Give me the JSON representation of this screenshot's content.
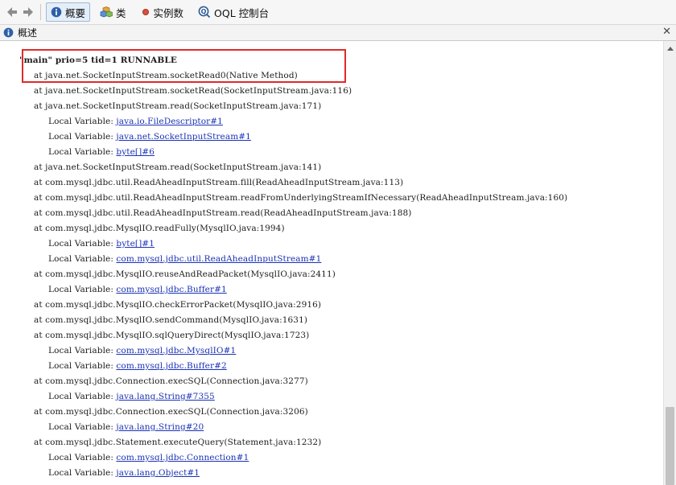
{
  "toolbar": {
    "tabs": [
      {
        "label": "概要",
        "icon": "info-icon"
      },
      {
        "label": "类",
        "icon": "classes-icon"
      },
      {
        "label": "实例数",
        "icon": "instances-icon"
      },
      {
        "label": "OQL 控制台",
        "icon": "oql-icon"
      }
    ]
  },
  "panel": {
    "title": "概述"
  },
  "thread": {
    "header": "\"main\" prio=5 tid=1 RUNNABLE",
    "lines": [
      {
        "kind": "frame",
        "text": "at java.net.SocketInputStream.socketRead0(Native Method)"
      },
      {
        "kind": "frame",
        "text": "at java.net.SocketInputStream.socketRead(SocketInputStream.java:116)"
      },
      {
        "kind": "frame",
        "text": "at java.net.SocketInputStream.read(SocketInputStream.java:171)"
      },
      {
        "kind": "local",
        "label": "Local Variable: ",
        "link": "java.io.FileDescriptor#1"
      },
      {
        "kind": "local",
        "label": "Local Variable: ",
        "link": "java.net.SocketInputStream#1"
      },
      {
        "kind": "local",
        "label": "Local Variable: ",
        "link": "byte[]#6"
      },
      {
        "kind": "frame",
        "text": "at java.net.SocketInputStream.read(SocketInputStream.java:141)"
      },
      {
        "kind": "frame",
        "text": "at com.mysql.jdbc.util.ReadAheadInputStream.fill(ReadAheadInputStream.java:113)"
      },
      {
        "kind": "frame",
        "text": "at com.mysql.jdbc.util.ReadAheadInputStream.readFromUnderlyingStreamIfNecessary(ReadAheadInputStream.java:160)"
      },
      {
        "kind": "frame",
        "text": "at com.mysql.jdbc.util.ReadAheadInputStream.read(ReadAheadInputStream.java:188)"
      },
      {
        "kind": "frame",
        "text": "at com.mysql.jdbc.MysqlIO.readFully(MysqlIO.java:1994)"
      },
      {
        "kind": "local",
        "label": "Local Variable: ",
        "link": "byte[]#1"
      },
      {
        "kind": "local",
        "label": "Local Variable: ",
        "link": "com.mysql.jdbc.util.ReadAheadInputStream#1"
      },
      {
        "kind": "frame",
        "text": "at com.mysql.jdbc.MysqlIO.reuseAndReadPacket(MysqlIO.java:2411)"
      },
      {
        "kind": "local",
        "label": "Local Variable: ",
        "link": "com.mysql.jdbc.Buffer#1"
      },
      {
        "kind": "frame",
        "text": "at com.mysql.jdbc.MysqlIO.checkErrorPacket(MysqlIO.java:2916)"
      },
      {
        "kind": "frame",
        "text": "at com.mysql.jdbc.MysqlIO.sendCommand(MysqlIO.java:1631)"
      },
      {
        "kind": "frame",
        "text": "at com.mysql.jdbc.MysqlIO.sqlQueryDirect(MysqlIO.java:1723)"
      },
      {
        "kind": "local",
        "label": "Local Variable: ",
        "link": "com.mysql.jdbc.MysqlIO#1"
      },
      {
        "kind": "local",
        "label": "Local Variable: ",
        "link": "com.mysql.jdbc.Buffer#2"
      },
      {
        "kind": "frame",
        "text": "at com.mysql.jdbc.Connection.execSQL(Connection.java:3277)"
      },
      {
        "kind": "local",
        "label": "Local Variable: ",
        "link": "java.lang.String#7355"
      },
      {
        "kind": "frame",
        "text": "at com.mysql.jdbc.Connection.execSQL(Connection.java:3206)"
      },
      {
        "kind": "local",
        "label": "Local Variable: ",
        "link": "java.lang.String#20"
      },
      {
        "kind": "frame",
        "text": "at com.mysql.jdbc.Statement.executeQuery(Statement.java:1232)"
      },
      {
        "kind": "local",
        "label": "Local Variable: ",
        "link": "com.mysql.jdbc.Connection#1"
      },
      {
        "kind": "local",
        "label": "Local Variable: ",
        "link": "java.lang.Object#1"
      }
    ]
  },
  "colors": {
    "link": "#1a32b5",
    "highlight": "#e12a2a",
    "text": "#1c1c1c"
  }
}
